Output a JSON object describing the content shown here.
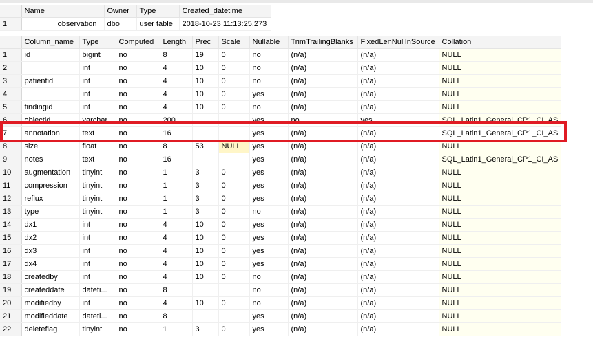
{
  "top_grid": {
    "headers": [
      "",
      "Name",
      "Owner",
      "Type",
      "Created_datetime"
    ],
    "rows": [
      {
        "rownum": "1",
        "name": "observation",
        "owner": "dbo",
        "type": "user table",
        "created": "2018-10-23 11:13:25.273"
      }
    ]
  },
  "columns_grid": {
    "headers": [
      "",
      "Column_name",
      "Type",
      "Computed",
      "Length",
      "Prec",
      "Scale",
      "Nullable",
      "TrimTrailingBlanks",
      "FixedLenNullInSource",
      "Collation"
    ],
    "rows": [
      {
        "rownum": "1",
        "column": "id",
        "type": "bigint",
        "computed": "no",
        "length": "8",
        "prec": "19",
        "scale": "0",
        "nullable": "no",
        "trim": "(n/a)",
        "fixed": "(n/a)",
        "collation": "NULL"
      },
      {
        "rownum": "2",
        "column": "",
        "type": "int",
        "computed": "no",
        "length": "4",
        "prec": "10",
        "scale": "0",
        "nullable": "no",
        "trim": "(n/a)",
        "fixed": "(n/a)",
        "collation": "NULL"
      },
      {
        "rownum": "3",
        "column": "patientid",
        "type": "int",
        "computed": "no",
        "length": "4",
        "prec": "10",
        "scale": "0",
        "nullable": "no",
        "trim": "(n/a)",
        "fixed": "(n/a)",
        "collation": "NULL"
      },
      {
        "rownum": "4",
        "column": "",
        "type": "int",
        "computed": "no",
        "length": "4",
        "prec": "10",
        "scale": "0",
        "nullable": "yes",
        "trim": "(n/a)",
        "fixed": "(n/a)",
        "collation": "NULL"
      },
      {
        "rownum": "5",
        "column": "findingid",
        "type": "int",
        "computed": "no",
        "length": "4",
        "prec": "10",
        "scale": "0",
        "nullable": "no",
        "trim": "(n/a)",
        "fixed": "(n/a)",
        "collation": "NULL"
      },
      {
        "rownum": "6",
        "column": "objectid",
        "type": "varchar",
        "computed": "no",
        "length": "200",
        "prec": "",
        "scale": "",
        "nullable": "yes",
        "trim": "no",
        "fixed": "yes",
        "collation": "SQL_Latin1_General_CP1_CI_AS"
      },
      {
        "rownum": "7",
        "column": "annotation",
        "type": "text",
        "computed": "no",
        "length": "16",
        "prec": "",
        "scale": "",
        "nullable": "yes",
        "trim": "(n/a)",
        "fixed": "(n/a)",
        "collation": "SQL_Latin1_General_CP1_CI_AS"
      },
      {
        "rownum": "8",
        "column": "size",
        "type": "float",
        "computed": "no",
        "length": "8",
        "prec": "53",
        "scale": "NULL",
        "nullable": "yes",
        "trim": "(n/a)",
        "fixed": "(n/a)",
        "collation": "NULL"
      },
      {
        "rownum": "9",
        "column": "notes",
        "type": "text",
        "computed": "no",
        "length": "16",
        "prec": "",
        "scale": "",
        "nullable": "yes",
        "trim": "(n/a)",
        "fixed": "(n/a)",
        "collation": "SQL_Latin1_General_CP1_CI_AS"
      },
      {
        "rownum": "10",
        "column": "augmentation",
        "type": "tinyint",
        "computed": "no",
        "length": "1",
        "prec": "3",
        "scale": "0",
        "nullable": "yes",
        "trim": "(n/a)",
        "fixed": "(n/a)",
        "collation": "NULL"
      },
      {
        "rownum": "11",
        "column": "compression",
        "type": "tinyint",
        "computed": "no",
        "length": "1",
        "prec": "3",
        "scale": "0",
        "nullable": "yes",
        "trim": "(n/a)",
        "fixed": "(n/a)",
        "collation": "NULL"
      },
      {
        "rownum": "12",
        "column": "reflux",
        "type": "tinyint",
        "computed": "no",
        "length": "1",
        "prec": "3",
        "scale": "0",
        "nullable": "yes",
        "trim": "(n/a)",
        "fixed": "(n/a)",
        "collation": "NULL"
      },
      {
        "rownum": "13",
        "column": "type",
        "type": "tinyint",
        "computed": "no",
        "length": "1",
        "prec": "3",
        "scale": "0",
        "nullable": "no",
        "trim": "(n/a)",
        "fixed": "(n/a)",
        "collation": "NULL"
      },
      {
        "rownum": "14",
        "column": "dx1",
        "type": "int",
        "computed": "no",
        "length": "4",
        "prec": "10",
        "scale": "0",
        "nullable": "yes",
        "trim": "(n/a)",
        "fixed": "(n/a)",
        "collation": "NULL"
      },
      {
        "rownum": "15",
        "column": "dx2",
        "type": "int",
        "computed": "no",
        "length": "4",
        "prec": "10",
        "scale": "0",
        "nullable": "yes",
        "trim": "(n/a)",
        "fixed": "(n/a)",
        "collation": "NULL"
      },
      {
        "rownum": "16",
        "column": "dx3",
        "type": "int",
        "computed": "no",
        "length": "4",
        "prec": "10",
        "scale": "0",
        "nullable": "yes",
        "trim": "(n/a)",
        "fixed": "(n/a)",
        "collation": "NULL"
      },
      {
        "rownum": "17",
        "column": "dx4",
        "type": "int",
        "computed": "no",
        "length": "4",
        "prec": "10",
        "scale": "0",
        "nullable": "yes",
        "trim": "(n/a)",
        "fixed": "(n/a)",
        "collation": "NULL"
      },
      {
        "rownum": "18",
        "column": "createdby",
        "type": "int",
        "computed": "no",
        "length": "4",
        "prec": "10",
        "scale": "0",
        "nullable": "no",
        "trim": "(n/a)",
        "fixed": "(n/a)",
        "collation": "NULL"
      },
      {
        "rownum": "19",
        "column": "createddate",
        "type": "dateti...",
        "computed": "no",
        "length": "8",
        "prec": "",
        "scale": "",
        "nullable": "no",
        "trim": "(n/a)",
        "fixed": "(n/a)",
        "collation": "NULL"
      },
      {
        "rownum": "20",
        "column": "modifiedby",
        "type": "int",
        "computed": "no",
        "length": "4",
        "prec": "10",
        "scale": "0",
        "nullable": "no",
        "trim": "(n/a)",
        "fixed": "(n/a)",
        "collation": "NULL"
      },
      {
        "rownum": "21",
        "column": "modifieddate",
        "type": "dateti...",
        "computed": "no",
        "length": "8",
        "prec": "",
        "scale": "",
        "nullable": "yes",
        "trim": "(n/a)",
        "fixed": "(n/a)",
        "collation": "NULL"
      },
      {
        "rownum": "22",
        "column": "deleteflag",
        "type": "tinyint",
        "computed": "no",
        "length": "1",
        "prec": "3",
        "scale": "0",
        "nullable": "yes",
        "trim": "(n/a)",
        "fixed": "(n/a)",
        "collation": "NULL"
      }
    ]
  },
  "highlighted_row_index": 6,
  "colors": {
    "highlight_border": "#e01b24",
    "collation_bg": "#fffff0",
    "header_bg": "#f4f4f4"
  }
}
